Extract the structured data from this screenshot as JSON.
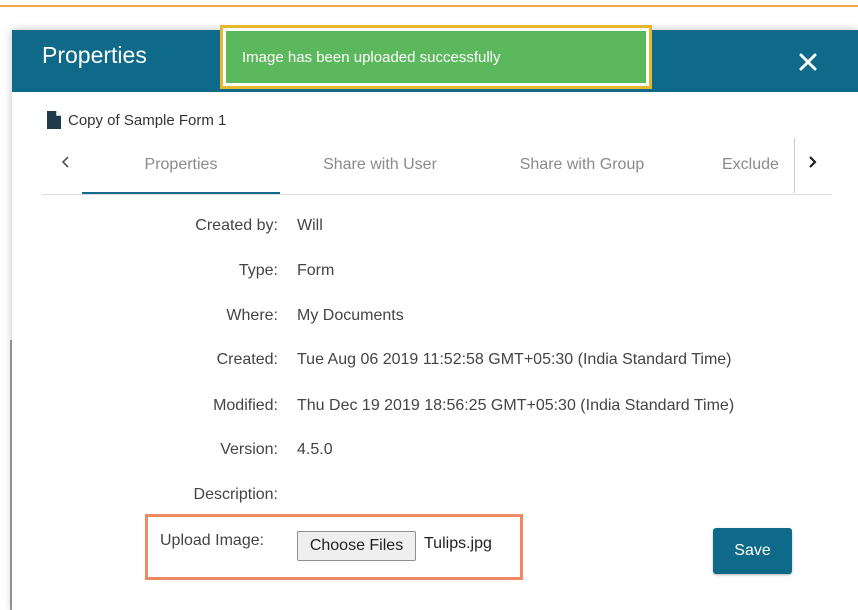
{
  "modal": {
    "title": "Properties",
    "document_name": "Copy of Sample Form 1"
  },
  "toast": {
    "message": "Image has been uploaded successfully"
  },
  "tabs": [
    {
      "label": "Properties",
      "active": true
    },
    {
      "label": "Share with User",
      "active": false
    },
    {
      "label": "Share with Group",
      "active": false
    },
    {
      "label": "Exclude",
      "active": false
    }
  ],
  "properties": [
    {
      "label": "Created by:",
      "value": "Will"
    },
    {
      "label": "Type:",
      "value": "Form"
    },
    {
      "label": "Where:",
      "value": "My Documents"
    },
    {
      "label": "Created:",
      "value": "Tue Aug 06 2019 11:52:58 GMT+05:30 (India Standard Time)"
    },
    {
      "label": "Modified:",
      "value": "Thu Dec 19 2019 18:56:25 GMT+05:30 (India Standard Time)"
    },
    {
      "label": "Version:",
      "value": "4.5.0"
    },
    {
      "label": "Description:",
      "value": ""
    }
  ],
  "upload": {
    "label": "Upload Image:",
    "button_label": "Choose Files",
    "file_name": "Tulips.jpg"
  },
  "actions": {
    "save_label": "Save"
  },
  "colors": {
    "header": "#0f6a8a",
    "toast_bg": "#5cb85c",
    "toast_border": "#e9b72e",
    "upload_highlight": "#ee8a63",
    "accent_line": "#f0a64b"
  },
  "icons": {
    "document": "document-icon",
    "close": "close-icon",
    "prev": "chevron-left-icon",
    "next": "chevron-right-icon"
  }
}
